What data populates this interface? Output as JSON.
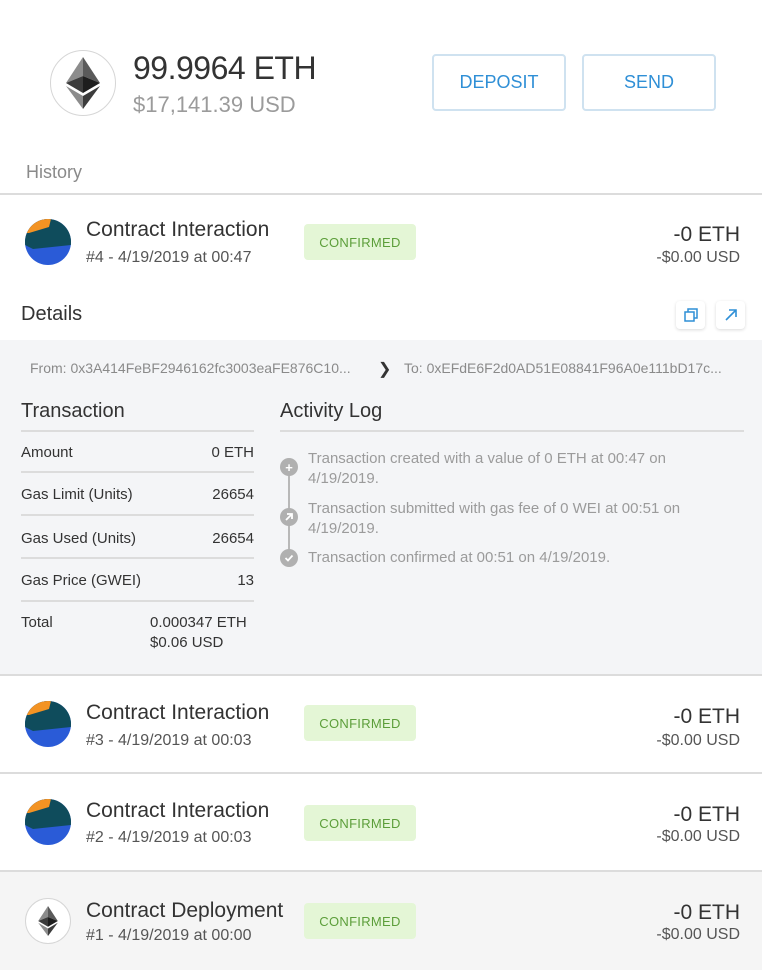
{
  "header": {
    "balance": "99.9964 ETH",
    "balance_usd": "$17,141.39 USD",
    "deposit_label": "DEPOSIT",
    "send_label": "SEND"
  },
  "history_label": "History",
  "colors": {
    "accent": "#2f8fd6",
    "confirmed_bg": "#e4f6d6",
    "confirmed_text": "#5c9e3a"
  },
  "transactions": [
    {
      "title": "Contract Interaction",
      "sub": "#4 - 4/19/2019 at 00:47",
      "status": "CONFIRMED",
      "amount": "-0 ETH",
      "usd": "-$0.00 USD",
      "icon": "contract-identicon"
    },
    {
      "title": "Contract Interaction",
      "sub": "#3 - 4/19/2019 at 00:03",
      "status": "CONFIRMED",
      "amount": "-0 ETH",
      "usd": "-$0.00 USD",
      "icon": "contract-identicon"
    },
    {
      "title": "Contract Interaction",
      "sub": "#2 - 4/19/2019 at 00:03",
      "status": "CONFIRMED",
      "amount": "-0 ETH",
      "usd": "-$0.00 USD",
      "icon": "contract-identicon"
    },
    {
      "title": "Contract Deployment",
      "sub": "#1 - 4/19/2019 at 00:00",
      "status": "CONFIRMED",
      "amount": "-0 ETH",
      "usd": "-$0.00 USD",
      "icon": "ethereum-icon"
    }
  ],
  "details": {
    "title": "Details",
    "from": "From: 0x3A414FeBF2946162fc3003eaFE876C10...",
    "to": "To: 0xEFdE6F2d0AD51E08841F96A0e111bD17c...",
    "transaction_title": "Transaction",
    "rows": [
      {
        "key": "Amount",
        "value": "0 ETH"
      },
      {
        "key": "Gas Limit (Units)",
        "value": "26654"
      },
      {
        "key": "Gas Used (Units)",
        "value": "26654"
      },
      {
        "key": "Gas Price (GWEI)",
        "value": "13"
      }
    ],
    "total_label": "Total",
    "total_eth": "0.000347 ETH",
    "total_usd": "$0.06 USD",
    "activity_title": "Activity Log",
    "activity": [
      {
        "text": "Transaction created with a value of 0 ETH at 00:47 on 4/19/2019.",
        "icon": "plus-icon"
      },
      {
        "text": "Transaction submitted with gas fee of 0 WEI at 00:51 on 4/19/2019.",
        "icon": "arrow-up-right-icon"
      },
      {
        "text": "Transaction confirmed at 00:51 on 4/19/2019.",
        "icon": "check-icon"
      }
    ]
  }
}
